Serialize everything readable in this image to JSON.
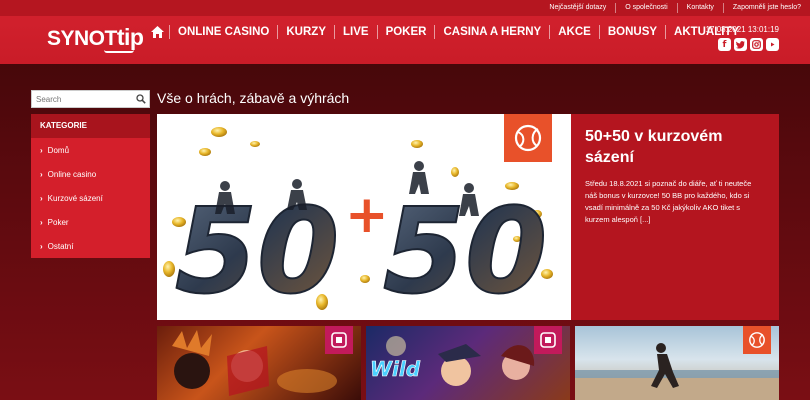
{
  "top_links": [
    "Nejčastější dotazy",
    "O společnosti",
    "Kontakty",
    "Zapomněli jste heslo?"
  ],
  "logo": {
    "part1": "SYNOT",
    "part2": "tip"
  },
  "nav": {
    "home_icon": "home-icon",
    "items": [
      "ONLINE CASINO",
      "KURZY",
      "LIVE",
      "POKER",
      "CASINA A HERNY",
      "AKCE",
      "BONUSY",
      "AKTUALITY"
    ]
  },
  "datetime": "17.08.2021 13:01:19",
  "social": [
    "facebook-icon",
    "twitter-icon",
    "instagram-icon",
    "youtube-icon"
  ],
  "search": {
    "placeholder": "Search"
  },
  "categories": {
    "heading": "KATEGORIE",
    "items": [
      "Domů",
      "Online casino",
      "Kurzové sázení",
      "Poker",
      "Ostatní"
    ]
  },
  "page_title": "Vše o hrách, zábavě a výhrách",
  "hero": {
    "image_text_left": "50",
    "image_text_plus": "+",
    "image_text_right": "50",
    "badge_icon": "tennis-ball-icon",
    "title": "50+50 v kurzovém sázení",
    "description": "Středu 18.8.2021 si poznač do diáře, ať ti neuteče náš bonus v kurzovce! 50 BB pro každého, kdo si vsadí minimálně za 50 Kč jakýkoliv AKO tiket s kurzem alespoň [...]"
  },
  "thumbs": [
    {
      "badge_icon": "slot-icon"
    },
    {
      "badge_icon": "slot-icon",
      "image_text": "Wild"
    },
    {
      "badge_icon": "tennis-ball-icon"
    }
  ],
  "colors": {
    "brand_red": "#c91c28",
    "dark_red": "#a8141d",
    "badge_orange": "#e8512a",
    "badge_pink": "#c21a5b"
  }
}
